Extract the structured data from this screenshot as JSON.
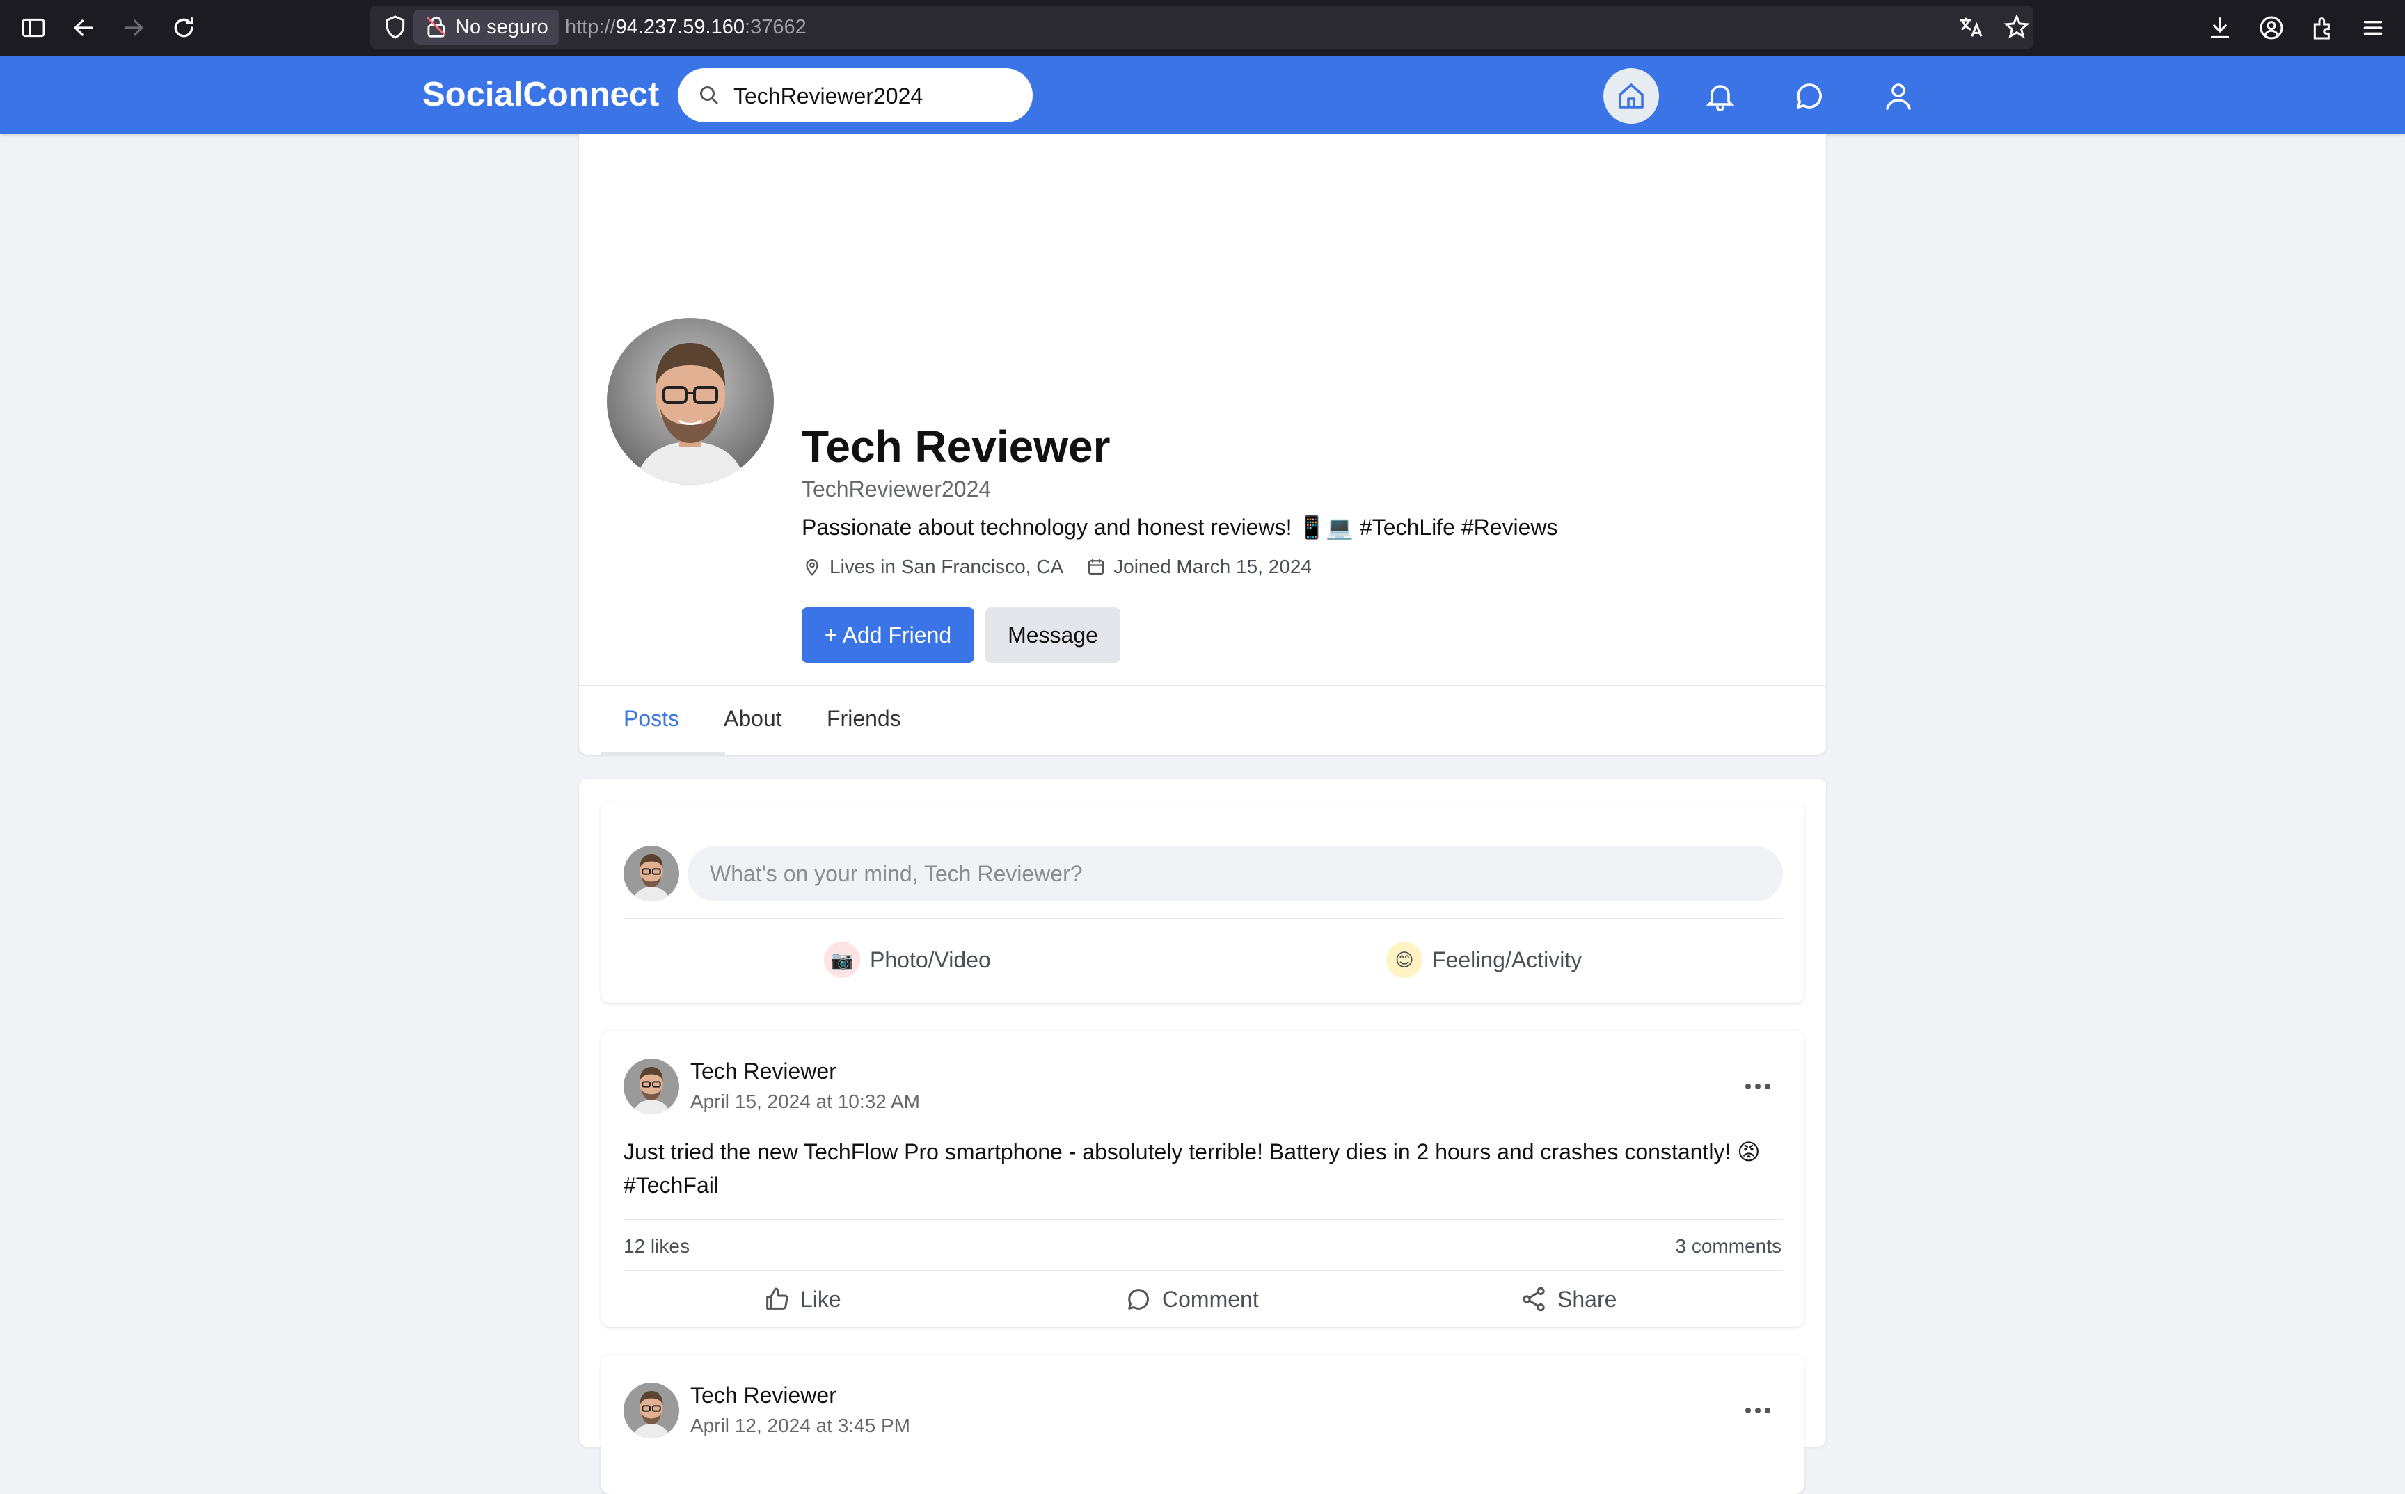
{
  "browser": {
    "security_label": "No seguro",
    "url_prefix": "http://",
    "url_host": "94.237.59.160",
    "url_port": ":37662"
  },
  "header": {
    "brand": "SocialConnect",
    "search_value": "TechReviewer2024"
  },
  "profile": {
    "name": "Tech Reviewer",
    "handle": "TechReviewer2024",
    "bio": "Passionate about technology and honest reviews! 📱💻 #TechLife #Reviews",
    "location": "Lives in San Francisco, CA",
    "joined": "Joined March 15, 2024",
    "add_friend_label": "+ Add Friend",
    "message_label": "Message"
  },
  "tabs": [
    {
      "label": "Posts",
      "active": true
    },
    {
      "label": "About"
    },
    {
      "label": "Friends"
    }
  ],
  "composer": {
    "placeholder": "What's on your mind, Tech Reviewer?",
    "photo_label": "Photo/Video",
    "photo_emoji": "📷",
    "feeling_label": "Feeling/Activity",
    "feeling_emoji": "😊"
  },
  "posts": [
    {
      "author": "Tech Reviewer",
      "time": "April 15, 2024 at 10:32 AM",
      "text": "Just tried the new TechFlow Pro smartphone - absolutely terrible! Battery dies in 2 hours and crashes constantly! 😡",
      "hashtag": "#TechFail",
      "likes": "12 likes",
      "comments": "3 comments",
      "actions": {
        "like": "Like",
        "comment": "Comment",
        "share": "Share"
      }
    },
    {
      "author": "Tech Reviewer",
      "time": "April 12, 2024 at 3:45 PM"
    }
  ],
  "colors": {
    "brand_blue": "#3b74e6",
    "page_bg": "#f0f2f5",
    "chrome_bg": "#1c1b22"
  }
}
